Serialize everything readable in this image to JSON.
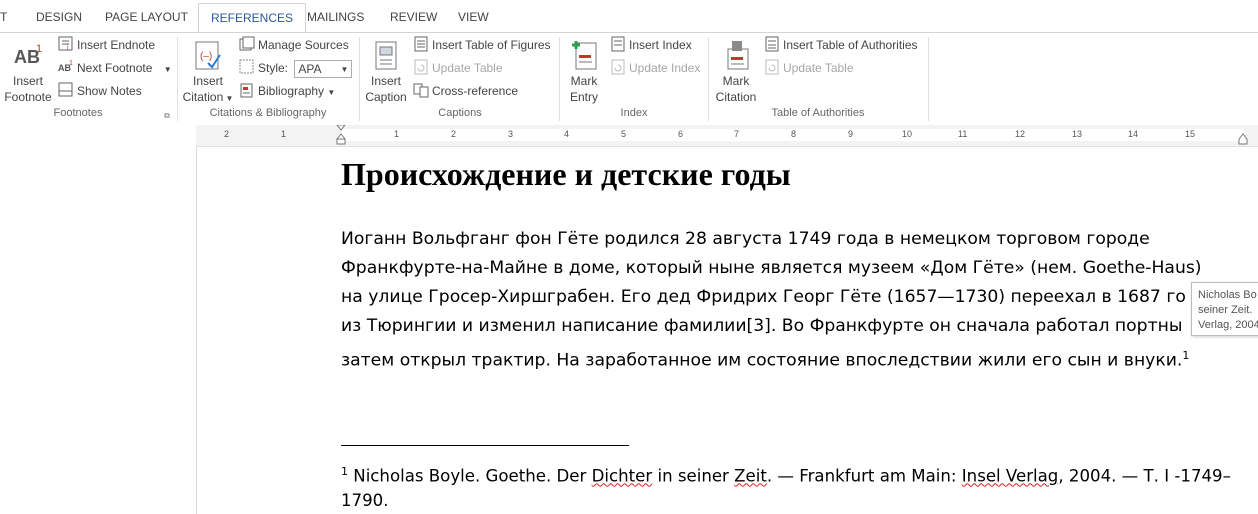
{
  "tabs": [
    "T",
    "DESIGN",
    "PAGE LAYOUT",
    "REFERENCES",
    "MAILINGS",
    "REVIEW",
    "VIEW"
  ],
  "active_tab": "REFERENCES",
  "ribbon": {
    "footnotes": {
      "insert_footnote": [
        "Insert",
        "Footnote"
      ],
      "insert_endnote": "Insert Endnote",
      "next_footnote": "Next Footnote",
      "show_notes": "Show Notes",
      "label": "Footnotes"
    },
    "citations": {
      "insert_citation": [
        "Insert",
        "Citation"
      ],
      "manage_sources": "Manage Sources",
      "style_label": "Style:",
      "style_value": "APA",
      "bibliography": "Bibliography",
      "label": "Citations & Bibliography"
    },
    "captions": {
      "insert_caption": [
        "Insert",
        "Caption"
      ],
      "insert_table_of_figures": "Insert Table of Figures",
      "update_table": "Update Table",
      "cross_reference": "Cross-reference",
      "label": "Captions"
    },
    "index": {
      "mark_entry": [
        "Mark",
        "Entry"
      ],
      "insert_index": "Insert Index",
      "update_index": "Update Index",
      "label": "Index"
    },
    "authorities": {
      "mark_citation": [
        "Mark",
        "Citation"
      ],
      "insert_table_of_authorities": "Insert Table of Authorities",
      "update_table": "Update Table",
      "label": "Table of Authorities"
    }
  },
  "ruler": {
    "left_ticks": [
      "2",
      "1"
    ],
    "ticks": [
      "1",
      "2",
      "3",
      "4",
      "5",
      "6",
      "7",
      "8",
      "9",
      "10",
      "11",
      "12",
      "13",
      "14",
      "15"
    ]
  },
  "document": {
    "heading": "Происхождение и детские годы",
    "paragraph_lines": [
      "Иоганн Вольфганг фон Гёте родился 28 августа 1749 года в немецком торговом городе",
      "Франкфурте-на-Майне в доме, который ныне является музеем «Дом Гёте» (нем. Goethe-Haus)",
      "на улице Гросер-Хиршграбен. Его дед Фридрих Георг Гёте (1657—1730) переехал в 1687 го",
      "из Тюрингии и изменил написание фамилии[3]. Во Франкфурте он сначала работал портны",
      "затем открыл трактир. На заработанное им состояние впоследствии жили его сын и внуки."
    ],
    "footnote_ref": "1",
    "footnote": {
      "number": "1",
      "part1": " Nicholas Boyle. Goethe. Der ",
      "w1": "Dichter",
      "part2": " in seiner ",
      "w2": "Zeit",
      "part3": ". — Frankfurt am Main: ",
      "w3": "Insel Verlag",
      "part4": ", 2004. — Т. I -1749–",
      "line2": "1790."
    },
    "tooltip_lines": [
      "Nicholas Bo",
      "seiner Zeit.",
      "Verlag, 2004"
    ]
  }
}
